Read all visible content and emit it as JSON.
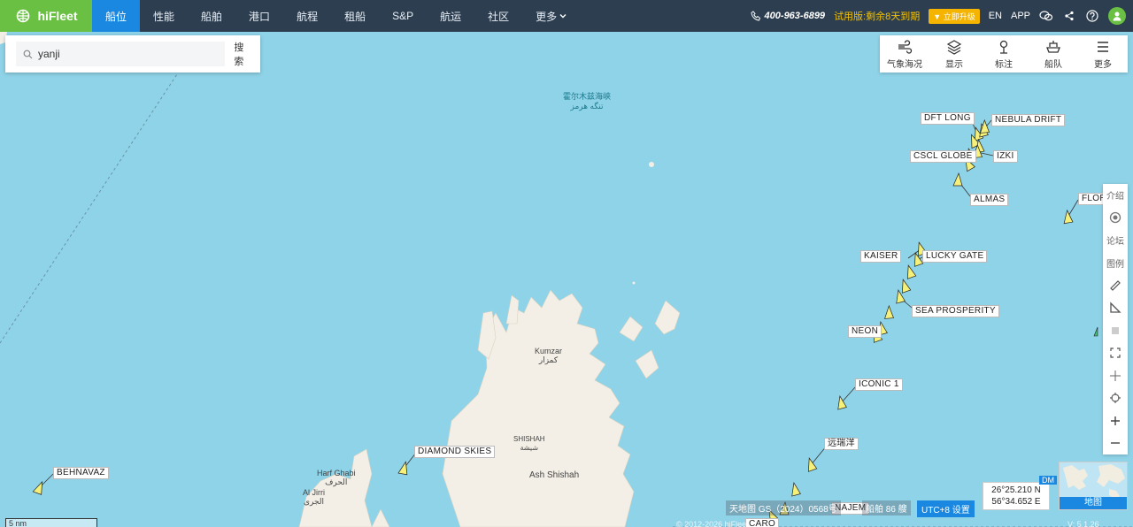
{
  "brand": {
    "name": "hiFleet"
  },
  "nav": {
    "tabs": [
      {
        "label": "船位"
      },
      {
        "label": "性能"
      },
      {
        "label": "船舶"
      },
      {
        "label": "港口"
      },
      {
        "label": "航程"
      },
      {
        "label": "租船"
      },
      {
        "label": "S&P"
      },
      {
        "label": "航运"
      },
      {
        "label": "社区"
      },
      {
        "label": "更多"
      }
    ],
    "active": "船位"
  },
  "header": {
    "phone": "400-963-6899",
    "trial": "试用版:剩余8天到期",
    "upgrade": "立即升级",
    "lang": "EN",
    "app": "APP"
  },
  "search": {
    "value": "yanji",
    "button": "搜索"
  },
  "toolbar": {
    "items": [
      {
        "label": "气象海况",
        "icon": "wind-icon"
      },
      {
        "label": "显示",
        "icon": "layers-icon"
      },
      {
        "label": "标注",
        "icon": "pin-icon"
      },
      {
        "label": "船队",
        "icon": "ship-icon"
      },
      {
        "label": "更多",
        "icon": "menu-icon"
      }
    ]
  },
  "sidetools": {
    "intro": "介绍",
    "forum": "论坛",
    "legend": "图例"
  },
  "map": {
    "strait_cn": "霍尔木兹海峡",
    "strait_fa": "تنگه هرمز",
    "places": [
      {
        "name": "Kumzar",
        "local": "كمزار"
      },
      {
        "name": "SHISHAH",
        "local": "شيشة"
      },
      {
        "name": "Ash Shishah",
        "local": ""
      },
      {
        "name": "Harf Ghabi",
        "local": "الحرف"
      },
      {
        "name": "Al Jirri",
        "local": "الجرى"
      }
    ],
    "ships": [
      {
        "name": "DFT LONG"
      },
      {
        "name": "NEBULA DRIFT"
      },
      {
        "name": "CSCL GLOBE"
      },
      {
        "name": "IZKI"
      },
      {
        "name": "ALMAS"
      },
      {
        "name": "FLOR"
      },
      {
        "name": "KAISER"
      },
      {
        "name": "LUCKY GATE"
      },
      {
        "name": "SEA PROSPERITY"
      },
      {
        "name": "NEON"
      },
      {
        "name": "ICONIC 1"
      },
      {
        "name": "远瑞洋"
      },
      {
        "name": "DIAMOND SKIES"
      },
      {
        "name": "BEHNAVAZ"
      },
      {
        "name": "NAJEM"
      },
      {
        "name": "CARO"
      }
    ]
  },
  "footer": {
    "attribution": "天地图 GS（2024）0568号",
    "ships_count": "船舶 86 艘",
    "utc": "UTC+8 设置",
    "lat": "26°25.210 N",
    "lon": "56°34.652 E",
    "dm": "DM",
    "minimap": "地图",
    "scale": "5 nm",
    "copyright": "© 2012-2026 hiFleet",
    "version": "V: 5.1.26"
  },
  "colors": {
    "topbar": "#2c3e50",
    "logo_bg": "#6ac043",
    "active_tab": "#1a88e0",
    "sea": "#8fd3e8",
    "land": "#f3efe6",
    "ship_fill": "#f5f07a"
  }
}
